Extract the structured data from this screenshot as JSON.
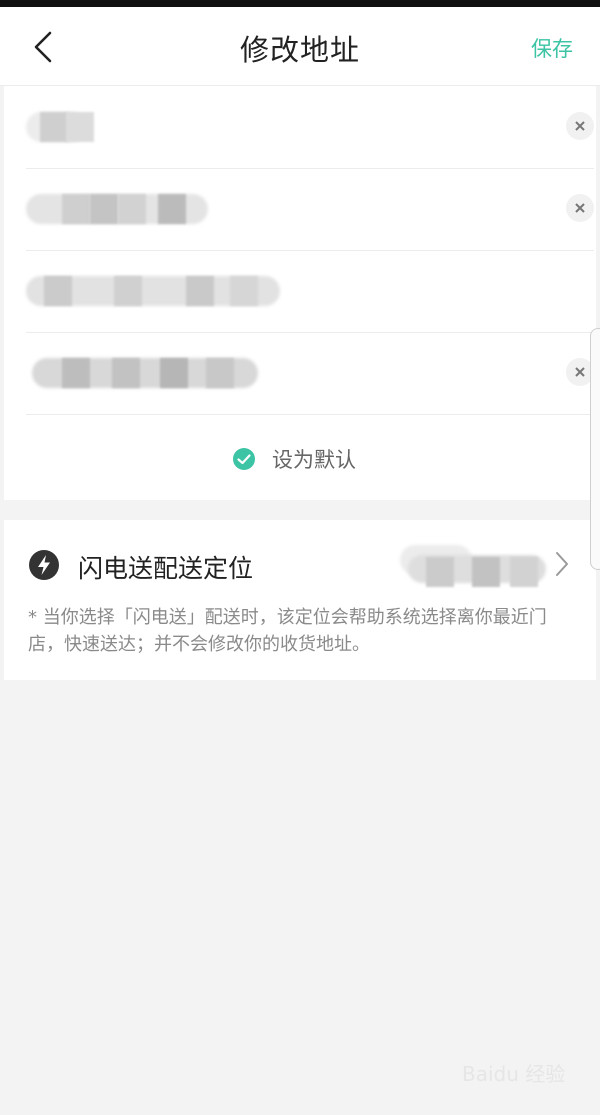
{
  "header": {
    "title": "修改地址",
    "save_label": "保存"
  },
  "form": {
    "fields": [
      {
        "name": "name",
        "value_hidden": true,
        "clearable": true
      },
      {
        "name": "phone",
        "value_hidden": true,
        "clearable": true
      },
      {
        "name": "region",
        "value_hidden": true,
        "clearable": false
      },
      {
        "name": "detail-address",
        "value_hidden": true,
        "clearable": true
      }
    ],
    "default_label": "设为默认",
    "default_checked": true
  },
  "delivery": {
    "label": "闪电送配送定位",
    "note": "* 当你选择「闪电送」配送时，该定位会帮助系统选择离你最近门店，快速送达；并不会修改你的收货地址。"
  },
  "colors": {
    "accent": "#3cc4a4",
    "background": "#f3f3f3",
    "card": "#ffffff"
  },
  "icons": {
    "back": "chevron-left-icon",
    "clear": "close-icon",
    "check": "check-circle-icon",
    "bolt": "lightning-bolt-icon",
    "chevron": "chevron-right-icon"
  }
}
